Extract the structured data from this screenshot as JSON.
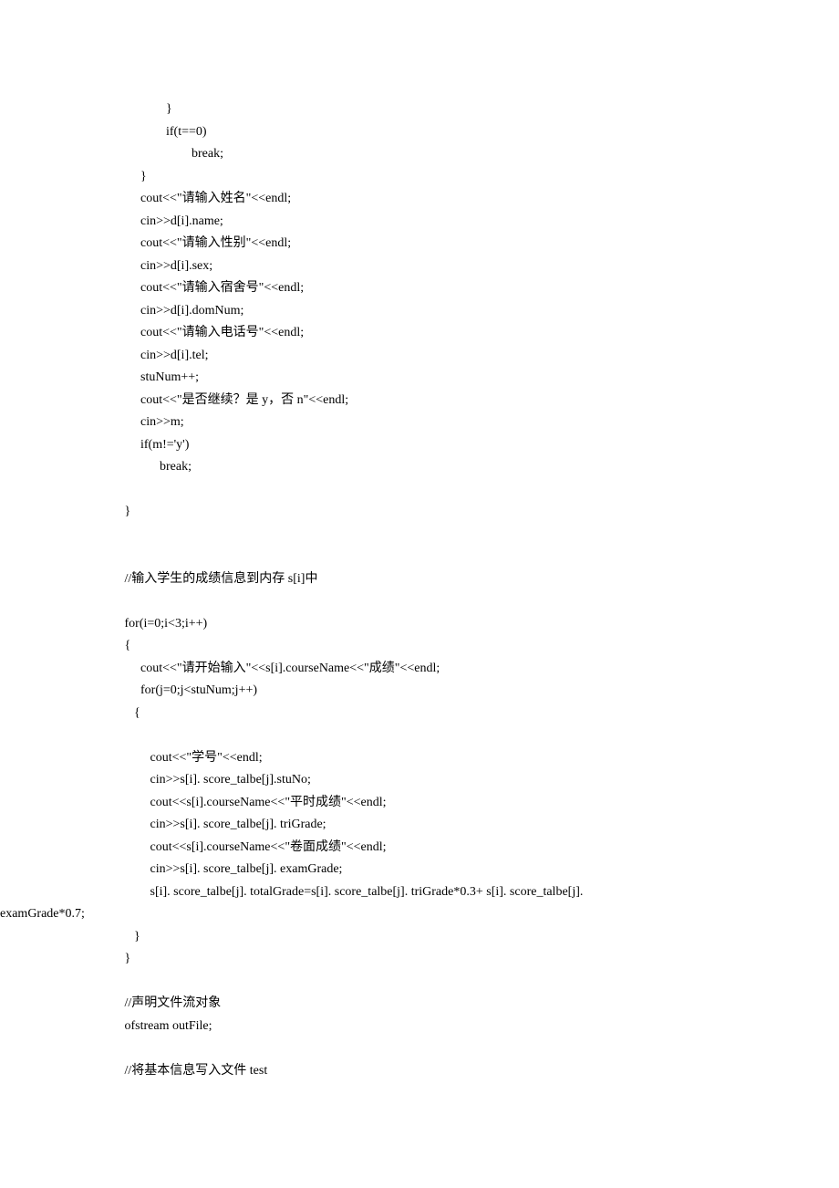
{
  "lines": [
    "                    }",
    "                    if(t==0)",
    "                            break;",
    "            }",
    "            cout<<\"请输入姓名\"<<endl;",
    "            cin>>d[i].name;",
    "            cout<<\"请输入性别\"<<endl;",
    "            cin>>d[i].sex;",
    "            cout<<\"请输入宿舍号\"<<endl;",
    "            cin>>d[i].domNum;",
    "            cout<<\"请输入电话号\"<<endl;",
    "            cin>>d[i].tel;",
    "            stuNum++;",
    "            cout<<\"是否继续？是 y，否 n\"<<endl;",
    "            cin>>m;",
    "            if(m!='y')",
    "                  break;",
    "",
    "       }",
    "",
    "",
    "       //输入学生的成绩信息到内存 s[i]中",
    "",
    "       for(i=0;i<3;i++)",
    "       {",
    "            cout<<\"请开始输入\"<<s[i].courseName<<\"成绩\"<<endl;",
    "            for(j=0;j<stuNum;j++)",
    "          {",
    "",
    "               cout<<\"学号\"<<endl;",
    "               cin>>s[i]. score_talbe[j].stuNo;",
    "               cout<<s[i].courseName<<\"平时成绩\"<<endl;",
    "               cin>>s[i]. score_talbe[j]. triGrade;",
    "               cout<<s[i].courseName<<\"卷面成绩\"<<endl;",
    "               cin>>s[i]. score_talbe[j]. examGrade;",
    "               s[i]. score_talbe[j]. totalGrade=s[i]. score_talbe[j]. triGrade*0.3+ s[i]. score_talbe[j].",
    "__WRAP__examGrade*0.7;",
    "          }",
    "       }",
    "",
    "       //声明文件流对象",
    "       ofstream outFile;",
    "",
    "       //将基本信息写入文件 test"
  ]
}
